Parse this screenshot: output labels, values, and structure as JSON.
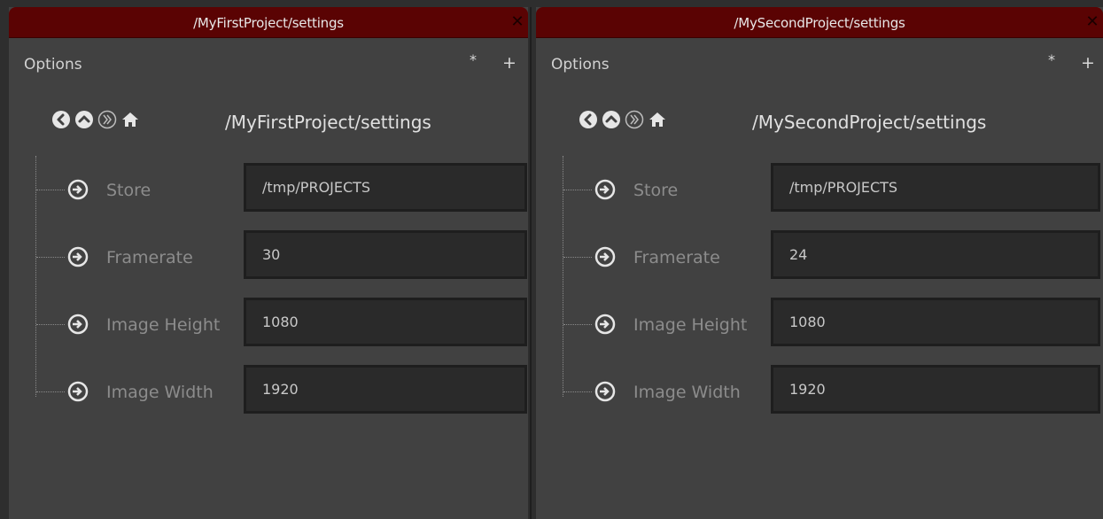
{
  "panels": [
    {
      "title": "/MyFirstProject/settings",
      "options_label": "Options",
      "star_label": "*",
      "plus_label": "+",
      "path": "/MyFirstProject/settings",
      "fields": [
        {
          "label": "Store",
          "value": "/tmp/PROJECTS"
        },
        {
          "label": "Framerate",
          "value": "30"
        },
        {
          "label": "Image Height",
          "value": "1080"
        },
        {
          "label": "Image Width",
          "value": "1920"
        }
      ]
    },
    {
      "title": "/MySecondProject/settings",
      "options_label": "Options",
      "star_label": "*",
      "plus_label": "+",
      "path": "/MySecondProject/settings",
      "fields": [
        {
          "label": "Store",
          "value": "/tmp/PROJECTS"
        },
        {
          "label": "Framerate",
          "value": "24"
        },
        {
          "label": "Image Height",
          "value": "1080"
        },
        {
          "label": "Image Width",
          "value": "1920"
        }
      ]
    }
  ],
  "icons": {
    "close": "close-icon",
    "back": "back-circle-icon",
    "up": "up-circle-icon",
    "forward": "forward-circle-icon",
    "home": "home-icon",
    "field": "arrow-right-circle-icon"
  },
  "colors": {
    "titlebar": "#5a0303",
    "panel": "#414141",
    "field_bg": "#2a2a2a",
    "label": "#8c8c8c",
    "text": "#e0e0e0"
  }
}
